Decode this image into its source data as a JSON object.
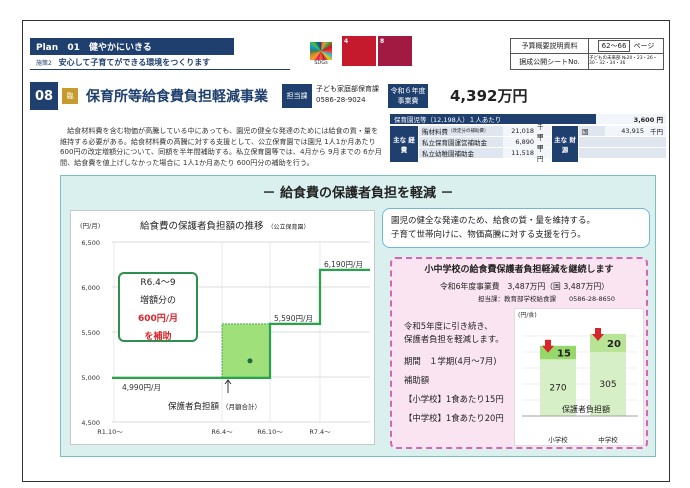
{
  "header": {
    "plan_label": "Plan",
    "plan_number": "01",
    "plan_title": "健やかにいきる",
    "policy_label": "施策2",
    "policy_title": "安心して子育てができる環境をつくります",
    "sdg_goals": [
      {
        "number": "4",
        "label": "質の高い教育を",
        "color": "#c5192d"
      },
      {
        "number": "8",
        "label": "働きがいも経済成長も",
        "color": "#a21942"
      }
    ],
    "sdg_wheel_label": "SDGs",
    "ref_rows": [
      {
        "label": "予算概要説明資料",
        "value": "62～66",
        "unit": "ページ"
      },
      {
        "label": "据成公開シートNo.",
        "value": "子どもの未来部 №20・23・26・30・32・34・36"
      }
    ]
  },
  "title": {
    "number": "08",
    "badge": "臨",
    "text": "保育所等給食費負担軽減事業",
    "tag_dept": "担当課",
    "dept_name": "子ども家庭部保育課",
    "dept_phone": "0586-28-9024",
    "tag_budget": "令和６年度 事業費",
    "amount": "4,392万円"
  },
  "description": "給食材料費を含む物価が高騰している中にあっても、園児の健全な発達のためには給食の質・量を維持する必要がある。給食材料費の高騰に対する支援として、公立保育園では園児 1人1か月あたり 600円の改定増額分について、同額を半年間補助する。私立保育園等では、4月から 9月までの 6か月間、給食費を値上げしなかった場合に 1人1か月あたり 600円分の補助を行う。",
  "budget": {
    "head_label": "保育園児等（12,198人）１人あたり",
    "head_value": "3,600 円",
    "side_main": "主な 経費",
    "side_fin": "主な 財源",
    "rows": [
      {
        "label": "賄材料費",
        "note": "（改定分の補助費）",
        "value": "21,018",
        "unit": "千円"
      },
      {
        "label": "私立保育園運営補助金",
        "note": "",
        "value": "6,890",
        "unit": "千円"
      },
      {
        "label": "私立幼稚園補助金",
        "note": "",
        "value": "11,518",
        "unit": "千円"
      }
    ],
    "fin_label": "国",
    "fin_value": "43,915",
    "fin_unit": "千円"
  },
  "panel_title": "－ 給食費の保護者負担を軽減 －",
  "chart": {
    "title": "給食費の保護者負担額の推移",
    "title_note": "（公立保育園）",
    "callout_line1": "R6.4～9",
    "callout_line2": "増額分の",
    "callout_line3": "600円/月",
    "callout_line4": "を補助",
    "arrow_label": "保護者負担額",
    "arrow_note": "（月額合計）"
  },
  "chart_data": [
    {
      "type": "line",
      "title": "給食費の保護者負担額の推移",
      "ylabel": "(円/月)",
      "ylim": [
        4500,
        6500
      ],
      "yticks": [
        4500,
        5000,
        5500,
        6000,
        6500
      ],
      "x_labels": [
        "R1.10～",
        "R6.4～",
        "R6.10～",
        "R7.4～"
      ],
      "series": [
        {
          "name": "",
          "points": [
            {
              "x": "R1.10～",
              "y": 4990
            },
            {
              "x": "R6.4～",
              "y": 4990
            },
            {
              "x": "R6.10～",
              "y": 5590
            },
            {
              "x": "R7.4～",
              "y": 6190
            }
          ]
        }
      ],
      "annotations": [
        "4,990円/月",
        "5,590円/月",
        "6,190円/月"
      ],
      "subsidy_band": {
        "from": "R6.4～",
        "to": "R6.10～",
        "low": 4990,
        "high": 5590
      }
    },
    {
      "type": "bar",
      "ylabel": "(円/食)",
      "categories": [
        "小学校",
        "中学校"
      ],
      "series": [
        {
          "name": "保護者負担額",
          "values": [
            270,
            305
          ]
        },
        {
          "name": "補助額",
          "values": [
            15,
            20
          ]
        }
      ]
    }
  ],
  "message": {
    "line1": "園児の健全な発達のため、給食の質・量を維持する。",
    "line2": "子育て世帯向けに、物価高騰に対する支援を行う。"
  },
  "school": {
    "title": "小中学校の給食費保護者負担軽減を継続します",
    "budget_line": "令和6年度事業費　3,487万円（国 3,487万円）",
    "dept_line": "担当課：教育部学校給食課　　0586-28-8650",
    "body1": "令和5年度に引き続き、",
    "body2": "保護者負担を軽減します。",
    "period": "期間　１学期(4月～7月)",
    "amount_label": "補助額",
    "elem": "【小学校】1食あたり15円",
    "junior": "【中学校】1食あたり20円",
    "mini_ylabel": "(円/食)",
    "mini_bar_label": "保護者負担額",
    "elem_top": "15",
    "elem_base": "270",
    "junior_top": "20",
    "junior_base": "305",
    "cat_elem": "小学校",
    "cat_junior": "中学校"
  }
}
